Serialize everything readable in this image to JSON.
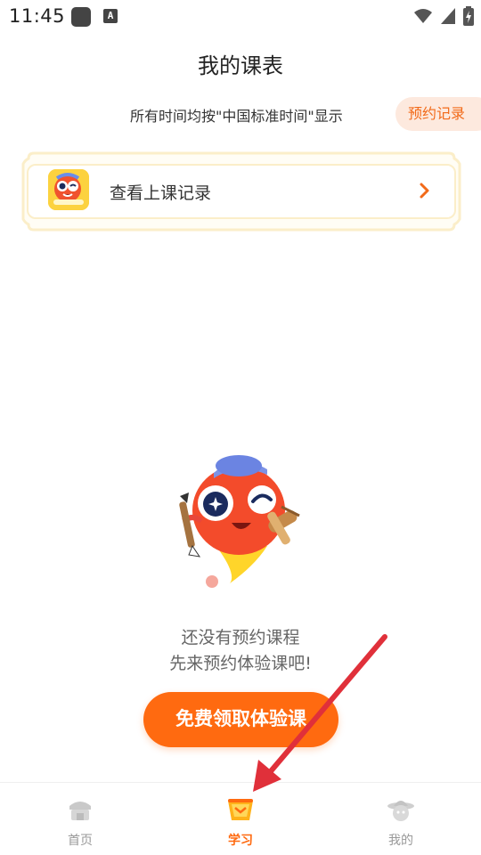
{
  "status_bar": {
    "time": "11:45",
    "notification_icons": [
      "app-square-icon",
      "a-text-icon"
    ],
    "system_icons": [
      "wifi-icon",
      "cell-signal-icon",
      "battery-icon"
    ]
  },
  "header": {
    "title": "我的课表",
    "timezone_note": "所有时间均按\"中国标准时间\"显示",
    "booking_record_label": "预约记录"
  },
  "record_card": {
    "label": "查看上课记录",
    "icon": "mascot-avatar-icon",
    "chevron": "chevron-right-icon"
  },
  "empty_state": {
    "line1": "还没有预约课程",
    "line2": "先来预约体验课吧!",
    "button_label": "免费领取体验课",
    "illustration": "mascot-icon"
  },
  "bottom_nav": {
    "items": [
      {
        "label": "首页",
        "icon": "home-icon",
        "active": false
      },
      {
        "label": "学习",
        "icon": "study-icon",
        "active": true
      },
      {
        "label": "我的",
        "icon": "profile-icon",
        "active": false
      }
    ]
  },
  "colors": {
    "accent": "#ff6a10",
    "pill_bg": "#fde9de",
    "pill_text": "#f26a19",
    "card_border": "#fbeec9",
    "arrow": "#e0303a"
  }
}
